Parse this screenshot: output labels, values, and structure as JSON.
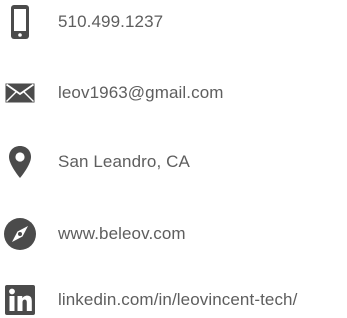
{
  "contact": {
    "phone": {
      "icon": "smartphone-icon",
      "text": "510.499.1237"
    },
    "email": {
      "icon": "envelope-icon",
      "text": "leov1963@gmail.com"
    },
    "location": {
      "icon": "map-pin-icon",
      "text": "San Leandro, CA"
    },
    "website": {
      "icon": "compass-icon",
      "text": "www.beleov.com"
    },
    "linkedin": {
      "icon": "linkedin-icon",
      "text": "linkedin.com/in/leovincent-tech/"
    }
  },
  "colors": {
    "icon": "#4b4b4b",
    "text": "#5e5e5e",
    "background": "#ffffff"
  }
}
